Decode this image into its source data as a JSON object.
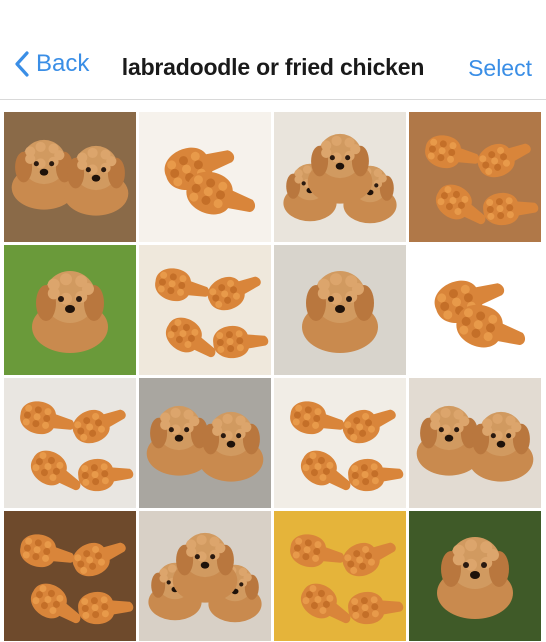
{
  "nav": {
    "back_label": "Back",
    "title": "labradoodle or fried chicken",
    "select_label": "Select"
  },
  "colors": {
    "accent": "#3a8ee6",
    "dog_fur": "#c98a4e",
    "chicken_crust": "#d9853a"
  },
  "grid": {
    "rows": 4,
    "columns": 4,
    "tiles": [
      {
        "subject": "labradoodle",
        "bg": "#8a6a48",
        "variant": "two-puppies-on-log"
      },
      {
        "subject": "fried-chicken",
        "bg": "#f6f2ec",
        "variant": "drumsticks"
      },
      {
        "subject": "labradoodle",
        "bg": "#e9e4dc",
        "variant": "puppy-pile"
      },
      {
        "subject": "fried-chicken",
        "bg": "#b07848",
        "variant": "basket"
      },
      {
        "subject": "labradoodle",
        "bg": "#6a9a3a",
        "variant": "puppy-on-grass"
      },
      {
        "subject": "fried-chicken",
        "bg": "#efe8dc",
        "variant": "bucket"
      },
      {
        "subject": "labradoodle",
        "bg": "#d8d4cc",
        "variant": "puppy-lying"
      },
      {
        "subject": "fried-chicken",
        "bg": "#ffffff",
        "variant": "drumsticks"
      },
      {
        "subject": "fried-chicken",
        "bg": "#e9e6e1",
        "variant": "plate"
      },
      {
        "subject": "labradoodle",
        "bg": "#a9a6a0",
        "variant": "puppies-in-bowl"
      },
      {
        "subject": "fried-chicken",
        "bg": "#f1ede6",
        "variant": "pile"
      },
      {
        "subject": "labradoodle",
        "bg": "#e2dbd2",
        "variant": "two-puppies-held"
      },
      {
        "subject": "fried-chicken",
        "bg": "#6e4a2c",
        "variant": "dark-pile"
      },
      {
        "subject": "labradoodle",
        "bg": "#d8d0c6",
        "variant": "puppy-pile"
      },
      {
        "subject": "fried-chicken",
        "bg": "#e5b43a",
        "variant": "on-lettuce"
      },
      {
        "subject": "labradoodle",
        "bg": "#3f5a28",
        "variant": "puppy-on-grass"
      }
    ]
  }
}
